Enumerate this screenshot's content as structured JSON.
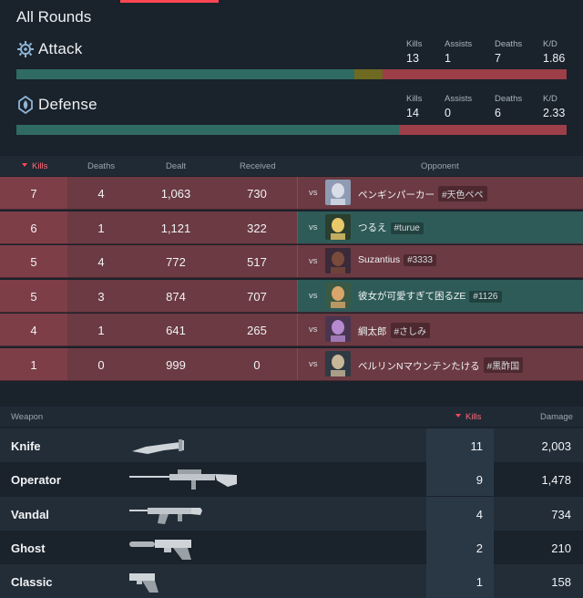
{
  "title": "All Rounds",
  "attack": {
    "name": "Attack",
    "kills_label": "Kills",
    "kills": "13",
    "assists_label": "Assists",
    "assists": "1",
    "deaths_label": "Deaths",
    "deaths": "7",
    "kd_label": "K/D",
    "kd": "1.86",
    "bar": {
      "win": 0.615,
      "other": 0.05,
      "loss": 0.335
    }
  },
  "defense": {
    "name": "Defense",
    "kills_label": "Kills",
    "kills": "14",
    "assists_label": "Assists",
    "assists": "0",
    "deaths_label": "Deaths",
    "deaths": "6",
    "kd_label": "K/D",
    "kd": "2.33",
    "bar": {
      "win": 0.695,
      "other": 0.0,
      "loss": 0.305
    }
  },
  "duel_table": {
    "headers": {
      "kills": "Kills",
      "deaths": "Deaths",
      "dealt": "Dealt",
      "received": "Received",
      "opponent": "Opponent"
    },
    "vs": "vs",
    "rows": [
      {
        "kills": "7",
        "deaths": "4",
        "dealt": "1,063",
        "received": "730",
        "name": "ペンギンパーカー",
        "tag": "#天色ペペ",
        "result": "loss"
      },
      {
        "kills": "6",
        "deaths": "1",
        "dealt": "1,121",
        "received": "322",
        "name": "つるえ",
        "tag": "#turue",
        "result": "win"
      },
      {
        "kills": "5",
        "deaths": "4",
        "dealt": "772",
        "received": "517",
        "name": "Suzantius",
        "tag": "#3333",
        "result": "loss"
      },
      {
        "kills": "5",
        "deaths": "3",
        "dealt": "874",
        "received": "707",
        "name": "彼女が可愛すぎて困るZE",
        "tag": "#1126",
        "result": "win"
      },
      {
        "kills": "4",
        "deaths": "1",
        "dealt": "641",
        "received": "265",
        "name": "綱太郎",
        "tag": "#さしみ",
        "result": "loss"
      },
      {
        "kills": "1",
        "deaths": "0",
        "dealt": "999",
        "received": "0",
        "name": "ベルリンNマウンテンたける",
        "tag": "#黒酢国",
        "result": "loss"
      }
    ]
  },
  "weapon_table": {
    "headers": {
      "weapon": "Weapon",
      "kills": "Kills",
      "damage": "Damage"
    },
    "rows": [
      {
        "name": "Knife",
        "kills": "11",
        "damage": "2,003",
        "icon": "knife-icon"
      },
      {
        "name": "Operator",
        "kills": "9",
        "damage": "1,478",
        "icon": "sniper-rifle-icon"
      },
      {
        "name": "Vandal",
        "kills": "4",
        "damage": "734",
        "icon": "assault-rifle-icon"
      },
      {
        "name": "Ghost",
        "kills": "2",
        "damage": "210",
        "icon": "pistol-suppressed-icon"
      },
      {
        "name": "Classic",
        "kills": "1",
        "damage": "158",
        "icon": "pistol-icon"
      }
    ]
  },
  "colors": {
    "win": "#2f6b63",
    "loss": "#9c3f48",
    "accent": "#ff4655"
  }
}
